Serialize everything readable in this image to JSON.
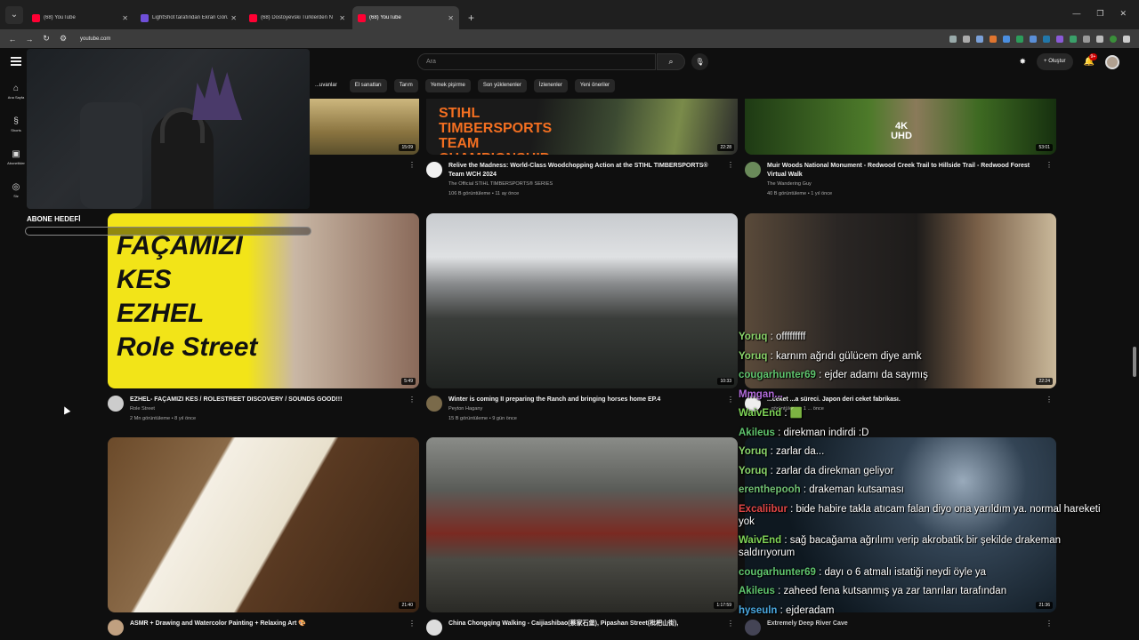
{
  "browser": {
    "tabs": [
      {
        "title": "(68) YouTube",
        "favicon": "youtube-icon",
        "active": false
      },
      {
        "title": "LightShot tarafından Ekran Görüntüsü",
        "favicon": "lightshot-icon",
        "active": false
      },
      {
        "title": "(68) Dostoyevski Türklerden N",
        "favicon": "youtube-icon",
        "active": false
      },
      {
        "title": "(68) YouTube",
        "favicon": "youtube-icon",
        "active": true
      }
    ],
    "url": "youtube.com"
  },
  "youtube": {
    "search_placeholder": "Ara",
    "create_label": "Oluştur",
    "notification_count": "9+",
    "rail": [
      {
        "label": "Ana Sayfa",
        "icon": "home-icon"
      },
      {
        "label": "Shorts",
        "icon": "shorts-icon"
      },
      {
        "label": "Abonelikler",
        "icon": "subscriptions-icon"
      },
      {
        "label": "Siz",
        "icon": "you-icon"
      }
    ],
    "chips": [
      "...uvanlar",
      "El sanatları",
      "Tarım",
      "Yemek pişirme",
      "Son yüklenenler",
      "İzlenenler",
      "Yeni öneriler"
    ],
    "videos": [
      {
        "title": "",
        "channel": "",
        "stats": "",
        "duration": "15:09"
      },
      {
        "title": "Relive the Madness: World-Class Woodchopping Action at the STIHL TIMBERSPORTS® Team WCH 2024",
        "channel": "The Official STIHL TIMBERSPORTS® SERIES",
        "stats": "106 B görüntüleme • 11 ay önce",
        "duration": "22:28",
        "thumb_text": "STIHL TIMBERSPORTS TEAM CHAMPIONSHIP 2024"
      },
      {
        "title": "Muir Woods National Monument - Redwood Creek Trail to Hillside Trail - Redwood Forest Virtual Walk",
        "channel": "The Wandering Guy",
        "stats": "40 B görüntüleme • 1 yıl önce",
        "duration": "53:01",
        "thumb_text": "4K UHD"
      },
      {
        "title": "EZHEL- FAÇAMIZI KES / ROLESTREET DISCOVERY / SOUNDS GOOD!!!",
        "channel": "Role Street",
        "stats": "2 Mn görüntüleme • 8 yıl önce",
        "duration": "5:49",
        "thumb_text": "FAÇAMIZI KES EZHEL Role Street"
      },
      {
        "title": "Winter is coming II preparing the Ranch and bringing horses home EP.4",
        "channel": "Peyton Hagany",
        "stats": "15 B görüntüleme • 9 gün önce",
        "duration": "10:33"
      },
      {
        "title": "...ceket ...a süreci. Japon deri ceket fabrikası.",
        "channel": "",
        "stats": "...görüntüleme • 1 ... önce",
        "duration": "22:24"
      },
      {
        "title": "ASMR + Drawing and Watercolor Painting + Relaxing Art 🎨",
        "channel": "",
        "stats": "",
        "duration": "21:40"
      },
      {
        "title": "China Chongqing Walking - Caijiashibao(蔡家石堡), Pipashan Street(枇杷山街),",
        "channel": "",
        "stats": "",
        "duration": "1:17:59"
      },
      {
        "title": "Extremely Deep River Cave",
        "channel": "",
        "stats": "",
        "duration": "21:36"
      }
    ]
  },
  "overlay": {
    "sub_goal_label": "ABONE HEDEFİ",
    "chat": [
      {
        "user": "Yoruq",
        "text": ": offfffffff",
        "color": "#8ad46a"
      },
      {
        "user": "Yoruq",
        "text": ": karnım ağrıdı gülücem diye amk",
        "color": "#8ad46a"
      },
      {
        "user": "cougarhunter69",
        "text": ": ejder adamı da saymış",
        "color": "#5fc46d"
      },
      {
        "user": "Mmgan...",
        "text": "",
        "color": "#b06ad8"
      },
      {
        "user": "WaivEnd",
        "text": ": 🟩",
        "color": "#7fd457"
      },
      {
        "user": "Akileus",
        "text": ": direkman indirdi :D",
        "color": "#5fc46d"
      },
      {
        "user": "Yoruq",
        "text": ": zarlar da...",
        "color": "#8ad46a"
      },
      {
        "user": "Yoruq",
        "text": ": zarlar da direkman geliyor",
        "color": "#8ad46a"
      },
      {
        "user": "erenthepooh",
        "text": ": drakeman kutsaması",
        "color": "#6fbf73"
      },
      {
        "user": "Excaliibur",
        "text": ": bide habire takla atıcam falan diyo ona yarıldım ya. normal hareketi yok",
        "color": "#e04646"
      },
      {
        "user": "WaivEnd",
        "text": ": sağ bacağama ağrılımı verip akrobatik bir şekilde drakeman saldırıyorum",
        "color": "#7fd457"
      },
      {
        "user": "cougarhunter69",
        "text": ": dayı o 6 atmalı istatiği neydi öyle ya",
        "color": "#5fc46d"
      },
      {
        "user": "Akileus",
        "text": ": zaheed fena kutsanmış ya zar tanrıları tarafından",
        "color": "#5fc46d"
      },
      {
        "user": "hyseuln",
        "text": ": ejderadam",
        "color": "#4aa8e0"
      }
    ]
  }
}
